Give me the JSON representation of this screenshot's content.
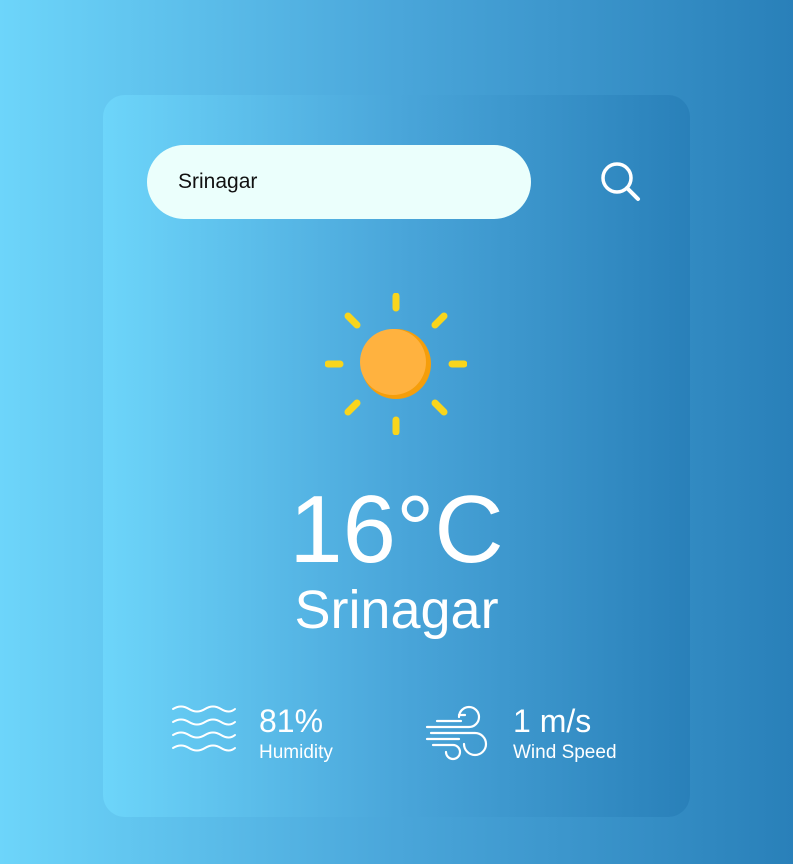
{
  "search": {
    "value": "Srinagar",
    "icon": "search-icon"
  },
  "weather": {
    "icon": "sun-icon",
    "temperature": "16°C",
    "city": "Srinagar"
  },
  "details": {
    "humidity": {
      "icon": "humidity-waves-icon",
      "value": "81%",
      "label": "Humidity"
    },
    "wind": {
      "icon": "wind-icon",
      "value": "1 m/s",
      "label": "Wind Speed"
    }
  },
  "colors": {
    "background_start": "#6dd5fa",
    "background_end": "#2980b9",
    "input_background": "#ebfffc",
    "sun_body": "#ffb23f",
    "sun_rays": "#f9d51c",
    "text": "#ffffff"
  }
}
